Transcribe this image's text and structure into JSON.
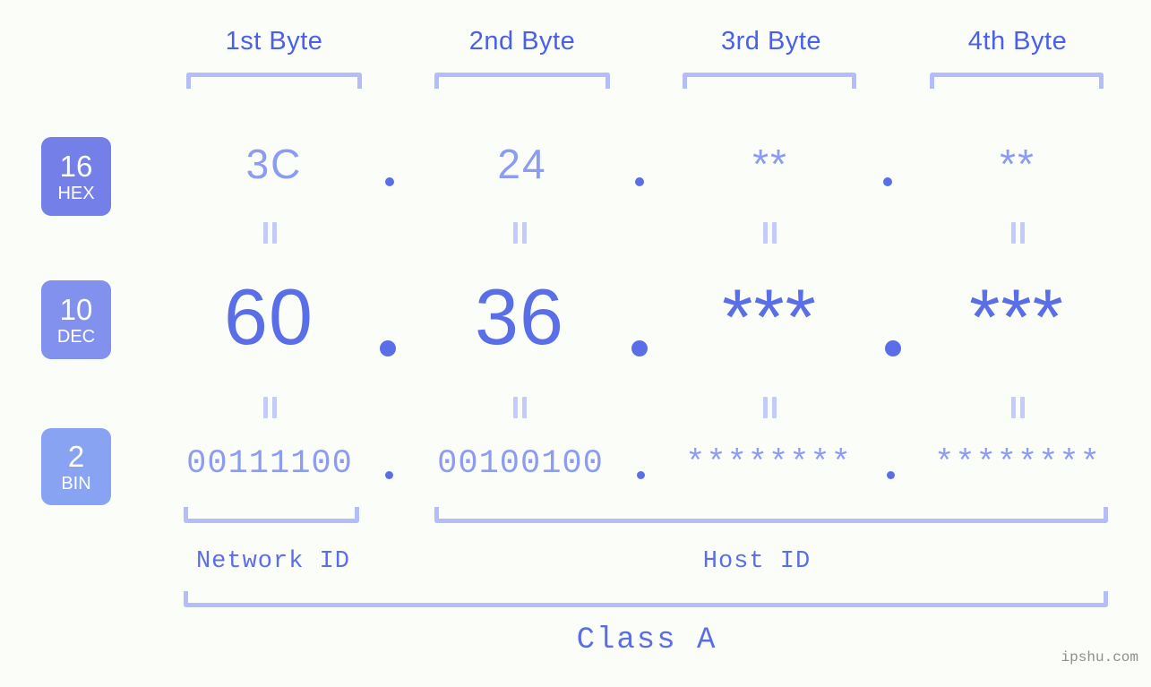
{
  "page": {
    "background_color": "#fbfdf8",
    "accent_color": "#5a6ee8",
    "light_accent_color": "#b4bdf8",
    "muted_value_color": "#8d9cf3"
  },
  "byte_headers": [
    {
      "label": "1st Byte"
    },
    {
      "label": "2nd Byte"
    },
    {
      "label": "3rd Byte"
    },
    {
      "label": "4th Byte"
    }
  ],
  "rows": [
    {
      "id": "hex",
      "badge_number": "16",
      "badge_name": "HEX",
      "badge_color": "#7480e8",
      "values": [
        "3C",
        "24",
        "**",
        "**"
      ],
      "separator": "."
    },
    {
      "id": "dec",
      "badge_number": "10",
      "badge_name": "DEC",
      "badge_color": "#8291ee",
      "values": [
        "60",
        "36",
        "***",
        "***"
      ],
      "separator": "."
    },
    {
      "id": "bin",
      "badge_number": "2",
      "badge_name": "BIN",
      "badge_color": "#88a3f2",
      "values": [
        "00111100",
        "00100100",
        "********",
        "********"
      ],
      "separator": "."
    }
  ],
  "equals_symbol": "=",
  "segments": [
    {
      "label": "Network ID"
    },
    {
      "label": "Host ID"
    }
  ],
  "class": {
    "label": "Class A"
  },
  "watermark": {
    "text": "ipshu.com"
  }
}
